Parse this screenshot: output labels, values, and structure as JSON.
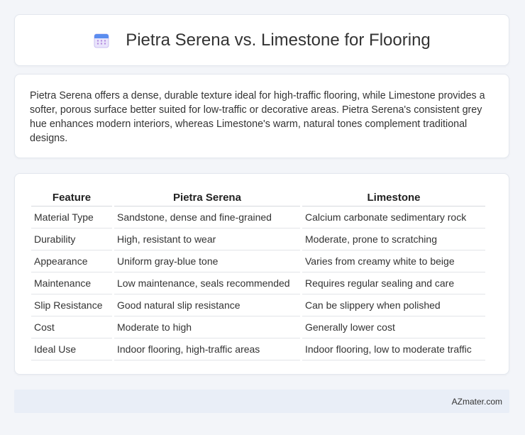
{
  "header": {
    "title": "Pietra Serena vs. Limestone for Flooring",
    "icon": "calendar-icon"
  },
  "intro": {
    "text": "Pietra Serena offers a dense, durable texture ideal for high-traffic flooring, while Limestone provides a softer, porous surface better suited for low-traffic or decorative areas. Pietra Serena's consistent grey hue enhances modern interiors, whereas Limestone's warm, natural tones complement traditional designs."
  },
  "table": {
    "headers": [
      "Feature",
      "Pietra Serena",
      "Limestone"
    ],
    "rows": [
      [
        "Material Type",
        "Sandstone, dense and fine-grained",
        "Calcium carbonate sedimentary rock"
      ],
      [
        "Durability",
        "High, resistant to wear",
        "Moderate, prone to scratching"
      ],
      [
        "Appearance",
        "Uniform gray-blue tone",
        "Varies from creamy white to beige"
      ],
      [
        "Maintenance",
        "Low maintenance, seals recommended",
        "Requires regular sealing and care"
      ],
      [
        "Slip Resistance",
        "Good natural slip resistance",
        "Can be slippery when polished"
      ],
      [
        "Cost",
        "Moderate to high",
        "Generally lower cost"
      ],
      [
        "Ideal Use",
        "Indoor flooring, high-traffic areas",
        "Indoor flooring, low to moderate traffic"
      ]
    ]
  },
  "footer": {
    "site": "AZmater.com"
  },
  "colors": {
    "page_bg": "#f3f5f9",
    "card_bg": "#ffffff",
    "footer_bg": "#e9eef7",
    "icon_accent": "#5b8def"
  }
}
